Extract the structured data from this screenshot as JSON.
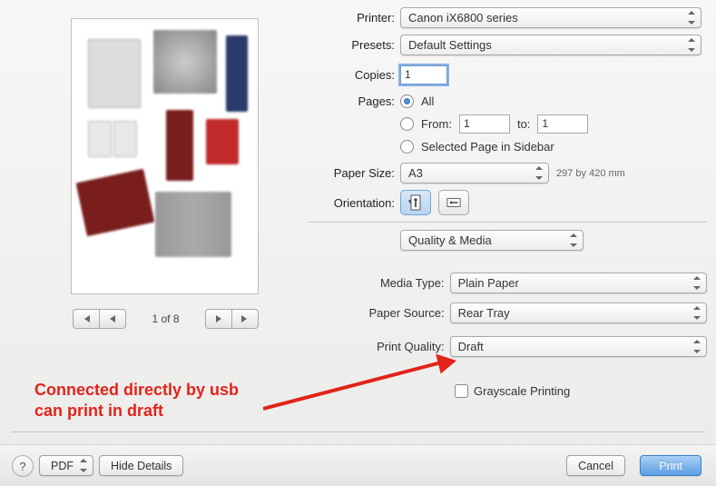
{
  "header": {
    "printer_label": "Printer:",
    "printer_value": "Canon iX6800 series",
    "presets_label": "Presets:",
    "presets_value": "Default Settings",
    "copies_label": "Copies:",
    "copies_value": "1",
    "pages_label": "Pages:",
    "pages_all": "All",
    "pages_from": "From:",
    "pages_from_value": "1",
    "pages_to": "to:",
    "pages_to_value": "1",
    "pages_selected": "Selected Page in Sidebar",
    "paper_size_label": "Paper Size:",
    "paper_size_value": "A3",
    "paper_dims": "297 by 420 mm",
    "orientation_label": "Orientation:",
    "section_value": "Quality & Media"
  },
  "media": {
    "media_type_label": "Media Type:",
    "media_type_value": "Plain Paper",
    "paper_source_label": "Paper Source:",
    "paper_source_value": "Rear Tray",
    "print_quality_label": "Print Quality:",
    "print_quality_value": "Draft",
    "grayscale_label": "Grayscale Printing"
  },
  "nav": {
    "page_indicator": "1 of 8"
  },
  "bottom": {
    "pdf_label": "PDF",
    "hide_label": "Hide Details",
    "cancel_label": "Cancel",
    "print_label": "Print",
    "help_label": "?"
  },
  "annotation": {
    "line1": "Connected directly by usb",
    "line2": "can print in draft"
  }
}
